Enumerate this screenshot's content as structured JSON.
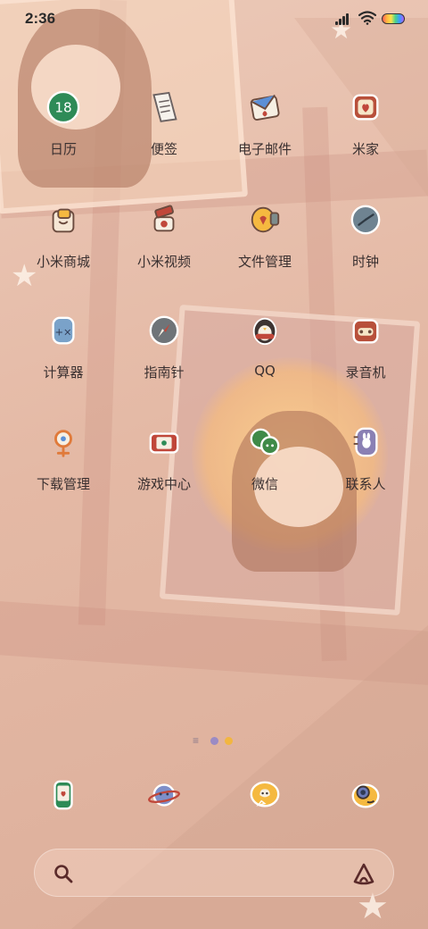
{
  "status_bar": {
    "time": "2:36"
  },
  "apps": [
    {
      "label": "日历",
      "icon": "calendar-icon",
      "badge": "18"
    },
    {
      "label": "便签",
      "icon": "notes-icon"
    },
    {
      "label": "电子邮件",
      "icon": "email-icon"
    },
    {
      "label": "米家",
      "icon": "mijia-home-icon"
    },
    {
      "label": "小米商城",
      "icon": "shopping-bag-icon"
    },
    {
      "label": "小米视频",
      "icon": "video-camera-icon"
    },
    {
      "label": "文件管理",
      "icon": "folder-icon"
    },
    {
      "label": "时钟",
      "icon": "clock-icon"
    },
    {
      "label": "计算器",
      "icon": "calculator-icon"
    },
    {
      "label": "指南针",
      "icon": "compass-icon"
    },
    {
      "label": "QQ",
      "icon": "penguin-icon"
    },
    {
      "label": "录音机",
      "icon": "recorder-icon"
    },
    {
      "label": "下载管理",
      "icon": "download-icon"
    },
    {
      "label": "游戏中心",
      "icon": "game-console-icon"
    },
    {
      "label": "微信",
      "icon": "chat-bubbles-icon"
    },
    {
      "label": "联系人",
      "icon": "contacts-icon"
    }
  ],
  "dock": [
    {
      "icon": "phone-icon"
    },
    {
      "icon": "planet-icon"
    },
    {
      "icon": "cat-message-icon"
    },
    {
      "icon": "camera-icon"
    }
  ],
  "page_indicator": {
    "page_count": 2,
    "current_page": 1,
    "colors": [
      "#9b8bc4",
      "#f2b640"
    ]
  },
  "colors": {
    "label_text": "#3a3030",
    "accent_red": "#c0473a",
    "calendar_green": "#2e8b57"
  }
}
